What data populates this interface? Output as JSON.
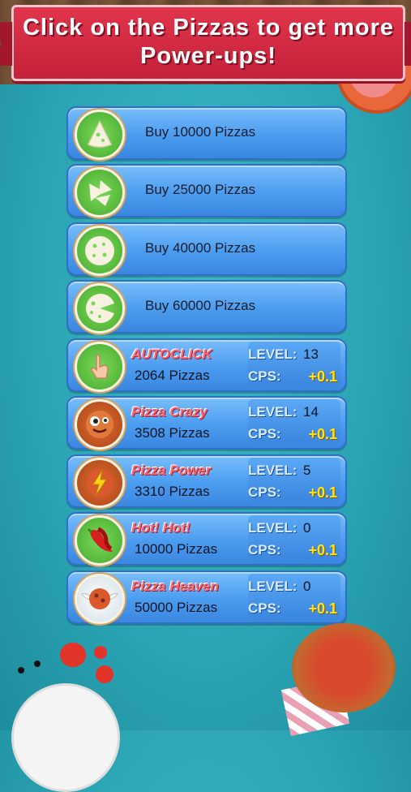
{
  "banner": {
    "text": "Click on the Pizzas to get more Power-ups!"
  },
  "buy_items": [
    {
      "label": "Buy 10000 Pizzas",
      "icon": "pizza-slice-icon"
    },
    {
      "label": "Buy 25000 Pizzas",
      "icon": "pizza-slices-icon"
    },
    {
      "label": "Buy 40000 Pizzas",
      "icon": "pizza-whole-icon"
    },
    {
      "label": "Buy 60000 Pizzas",
      "icon": "pizza-missing-slice-icon"
    }
  ],
  "powerups": [
    {
      "name": "AUTOCLICK",
      "cost": "2064 Pizzas",
      "level_label": "LEVEL:",
      "level": "13",
      "cps_label": "CPS:",
      "cps": "+0.1",
      "icon": "hand-click-icon"
    },
    {
      "name": "Pizza Crazy",
      "cost": "3508 Pizzas",
      "level_label": "LEVEL:",
      "level": "14",
      "cps_label": "CPS:",
      "cps": "+0.1",
      "icon": "crazy-pizza-icon"
    },
    {
      "name": "Pizza Power",
      "cost": "3310 Pizzas",
      "level_label": "LEVEL:",
      "level": "5",
      "cps_label": "CPS:",
      "cps": "+0.1",
      "icon": "lightning-pizza-icon"
    },
    {
      "name": "Hot! Hot!",
      "cost": "10000 Pizzas",
      "level_label": "LEVEL:",
      "level": "0",
      "cps_label": "CPS:",
      "cps": "+0.1",
      "icon": "chili-pepper-icon"
    },
    {
      "name": "Pizza Heaven",
      "cost": "50000 Pizzas",
      "level_label": "LEVEL:",
      "level": "0",
      "cps_label": "CPS:",
      "cps": "+0.1",
      "icon": "winged-pizza-icon"
    }
  ],
  "colors": {
    "accent_red": "#d02a43",
    "button_blue": "#4a9cf0",
    "cps_yellow": "#ffe21a",
    "background": "#2aa3b2"
  }
}
